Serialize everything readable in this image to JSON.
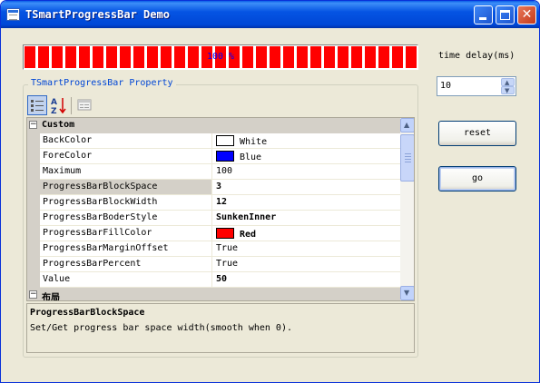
{
  "window": {
    "title": "TSmartProgressBar Demo"
  },
  "progress": {
    "text": "100 %",
    "value": 1.0,
    "fore_color": "#ff0000"
  },
  "controls": {
    "delay_label": "time delay(ms)",
    "delay_value": "10",
    "reset_label": "reset",
    "go_label": "go"
  },
  "group": {
    "label": "TSmartProgressBar Property"
  },
  "property_grid": {
    "categories": [
      "Custom",
      "布局"
    ],
    "rows": [
      {
        "name": "BackColor",
        "value": "White",
        "swatch": "#ffffff",
        "bold": false
      },
      {
        "name": "ForeColor",
        "value": "Blue",
        "swatch": "#0000ff",
        "bold": false
      },
      {
        "name": "Maximum",
        "value": "100",
        "bold": false
      },
      {
        "name": "ProgressBarBlockSpace",
        "value": "3",
        "bold": true,
        "selected": true
      },
      {
        "name": "ProgressBarBlockWidth",
        "value": "12",
        "bold": true
      },
      {
        "name": "ProgressBarBoderStyle",
        "value": "SunkenInner",
        "bold": true
      },
      {
        "name": "ProgressBarFillColor",
        "value": "Red",
        "swatch": "#ff0000",
        "bold": true
      },
      {
        "name": "ProgressBarMarginOffset",
        "value": "True",
        "bold": false
      },
      {
        "name": "ProgressBarPercent",
        "value": "True",
        "bold": false
      },
      {
        "name": "Value",
        "value": "50",
        "bold": true
      }
    ],
    "help_title": "ProgressBarBlockSpace",
    "help_description": "Set/Get progress bar space width(smooth when 0)."
  }
}
